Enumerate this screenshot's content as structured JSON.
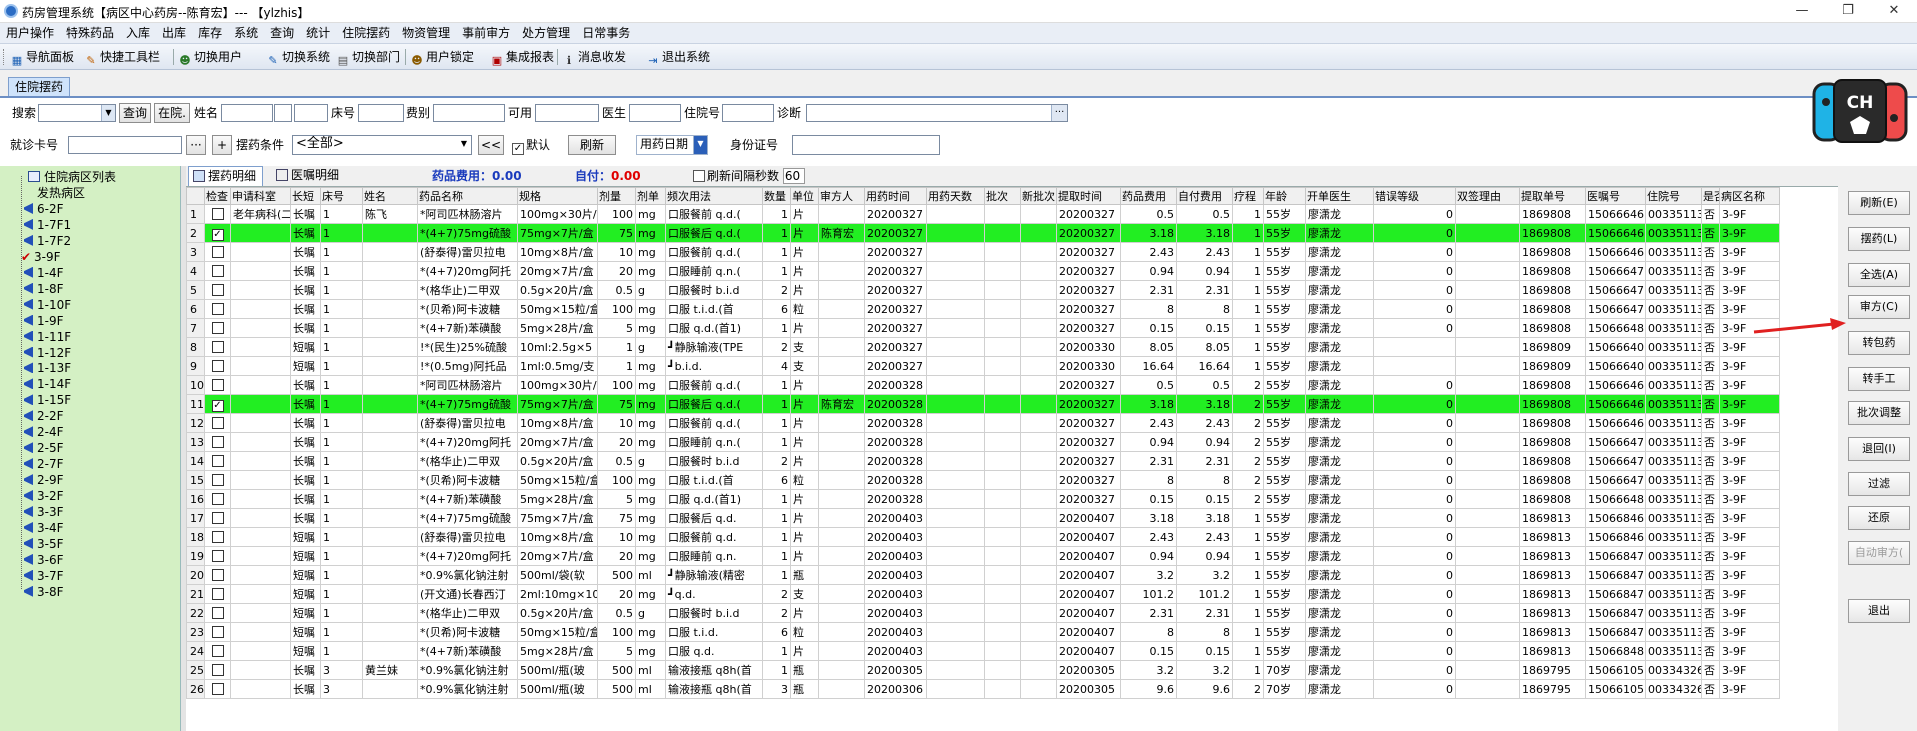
{
  "window": {
    "title": "药房管理系统【病区中心药房--陈育宏】--- 【ylzhis】",
    "min": "—",
    "max": "❐",
    "close": "✕"
  },
  "menu": [
    "用户操作",
    "特殊药品",
    "入库",
    "出库",
    "库存",
    "系统",
    "查询",
    "统计",
    "住院摆药",
    "物资管理",
    "事前审方",
    "处方管理",
    "日常事务"
  ],
  "toolbar": [
    {
      "label": "导航面板",
      "icon": "nav-panel-icon",
      "glyph": "▦",
      "color": "#1a5fb4"
    },
    {
      "label": "快捷工具栏",
      "icon": "shortcut-tools-icon",
      "glyph": "✎",
      "color": "#c06000"
    },
    {
      "label": "切换用户",
      "icon": "switch-user-icon",
      "glyph": "☻",
      "color": "#2a7a2a"
    },
    {
      "label": "切换系统",
      "icon": "switch-system-icon",
      "glyph": "✎",
      "color": "#1a5fb4"
    },
    {
      "label": "切换部门",
      "icon": "switch-dept-icon",
      "glyph": "▤",
      "color": "#555"
    },
    {
      "label": "用户锁定",
      "icon": "user-lock-icon",
      "glyph": "☻",
      "color": "#8a5a00"
    },
    {
      "label": "集成报表",
      "icon": "report-icon",
      "glyph": "▣",
      "color": "#b00000"
    },
    {
      "label": "消息收发",
      "icon": "message-icon",
      "glyph": "ℹ",
      "color": "#333"
    },
    {
      "label": "退出系统",
      "icon": "exit-icon",
      "glyph": "⇥",
      "color": "#1a5fb4"
    }
  ],
  "doc_tab": "住院摆药",
  "filters": {
    "search_label": "搜索",
    "query_btn": "查询",
    "inpatient_btn": "在院.",
    "name_label": "姓名",
    "bed_label": "床号",
    "fee_label": "费别",
    "usable_label": "可用",
    "doctor_label": "医生",
    "hosp_label": "住院号",
    "diag_label": "诊断",
    "diag_btn": "···",
    "card_label": "就诊卡号",
    "dots_btn": "···",
    "plus_btn": "+",
    "cond_label": "摆药条件",
    "cond_value": "<全部>",
    "back_btn": "<<",
    "default_label": "默认",
    "refresh_btn": "刷新",
    "date_value": "用药日期",
    "id_label": "身份证号"
  },
  "tree": {
    "root": "住院病区列表",
    "items": [
      "发热病区",
      "6-2F",
      "1-7F1",
      "1-7F2",
      "3-9F",
      "1-4F",
      "1-8F",
      "1-10F",
      "1-9F",
      "1-11F",
      "1-12F",
      "1-13F",
      "1-14F",
      "1-15F",
      "2-2F",
      "2-4F",
      "2-5F",
      "2-7F",
      "2-9F",
      "3-2F",
      "3-3F",
      "3-4F",
      "3-5F",
      "3-6F",
      "3-7F",
      "3-8F"
    ],
    "checked_item": "3-9F"
  },
  "main_tabs": [
    "摆药明细",
    "医嘱明细"
  ],
  "fee_bar": {
    "fee_label": "药品费用：",
    "fee_value": "0.00",
    "self_label": "自付：",
    "self_value": "0.00",
    "refresh_label": "刷新间隔秒数",
    "refresh_value": "60"
  },
  "columns": [
    "检查",
    "申请科室",
    "长短",
    "床号",
    "姓名",
    "药品名称",
    "规格",
    "剂量",
    "剂单",
    "频次用法",
    "数量",
    "单位",
    "审方人",
    "用药时间",
    "用药天数",
    "批次",
    "新批次",
    "提取时间",
    "药品费用",
    "自付费用",
    "疗程",
    "年龄",
    "开单医生",
    "错误等级",
    "双签理由",
    "提取单号",
    "医嘱号",
    "住院号",
    "是否",
    "病区名称"
  ],
  "rows": [
    [
      "1",
      "false",
      "老年病科(二",
      "长嘱",
      "1",
      "陈飞",
      "*阿司匹林肠溶片",
      "100mg×30片/",
      "100",
      "mg",
      "口服餐前 q.d.(",
      "1",
      "片",
      "",
      "20200327",
      "",
      "",
      "",
      "20200327",
      "0.5",
      "0.5",
      "1",
      "55岁",
      "廖潇龙",
      "0",
      "",
      "1869808",
      "15066646",
      "00335113",
      "否",
      "3-9F"
    ],
    [
      "2",
      "true",
      "",
      "长嘱",
      "1",
      "",
      "*(4+7)75mg硫酸",
      "75mg×7片/盒",
      "75",
      "mg",
      "口服餐后 q.d.(",
      "1",
      "片",
      "陈育宏",
      "20200327",
      "",
      "",
      "",
      "20200327",
      "3.18",
      "3.18",
      "1",
      "55岁",
      "廖潇龙",
      "0",
      "",
      "1869808",
      "15066646",
      "00335113",
      "否",
      "3-9F"
    ],
    [
      "3",
      "false",
      "",
      "长嘱",
      "1",
      "",
      "(舒泰得)雷贝拉电",
      "10mg×8片/盒",
      "10",
      "mg",
      "口服餐前 q.d.(",
      "1",
      "片",
      "",
      "20200327",
      "",
      "",
      "",
      "20200327",
      "2.43",
      "2.43",
      "1",
      "55岁",
      "廖潇龙",
      "0",
      "",
      "1869808",
      "15066646",
      "00335113",
      "否",
      "3-9F"
    ],
    [
      "4",
      "false",
      "",
      "长嘱",
      "1",
      "",
      "*(4+7)20mg阿托",
      "20mg×7片/盒",
      "20",
      "mg",
      "口服睡前 q.n.(",
      "1",
      "片",
      "",
      "20200327",
      "",
      "",
      "",
      "20200327",
      "0.94",
      "0.94",
      "1",
      "55岁",
      "廖潇龙",
      "0",
      "",
      "1869808",
      "15066647",
      "00335113",
      "否",
      "3-9F"
    ],
    [
      "5",
      "false",
      "",
      "长嘱",
      "1",
      "",
      "*(格华止)二甲双",
      "0.5g×20片/盒",
      "0.5",
      "g",
      "口服餐时 b.i.d",
      "2",
      "片",
      "",
      "20200327",
      "",
      "",
      "",
      "20200327",
      "2.31",
      "2.31",
      "1",
      "55岁",
      "廖潇龙",
      "0",
      "",
      "1869808",
      "15066647",
      "00335113",
      "否",
      "3-9F"
    ],
    [
      "6",
      "false",
      "",
      "长嘱",
      "1",
      "",
      "*(贝希)阿卡波糖",
      "50mg×15粒/盒",
      "100",
      "mg",
      "口服 t.i.d.(首",
      "6",
      "粒",
      "",
      "20200327",
      "",
      "",
      "",
      "20200327",
      "8",
      "8",
      "1",
      "55岁",
      "廖潇龙",
      "0",
      "",
      "1869808",
      "15066647",
      "00335113",
      "否",
      "3-9F"
    ],
    [
      "7",
      "false",
      "",
      "长嘱",
      "1",
      "",
      "*(4+7新)苯磺酸",
      "5mg×28片/盒",
      "5",
      "mg",
      "口服 q.d.(首1)",
      "1",
      "片",
      "",
      "20200327",
      "",
      "",
      "",
      "20200327",
      "0.15",
      "0.15",
      "1",
      "55岁",
      "廖潇龙",
      "0",
      "",
      "1869808",
      "15066648",
      "00335113",
      "否",
      "3-9F"
    ],
    [
      "8",
      "false",
      "",
      "短嘱",
      "1",
      "",
      "!*(民生)25%硫酸",
      "10ml:2.5g×5",
      "1",
      "g",
      "┛静脉输液(TPE",
      "2",
      "支",
      "",
      "20200327",
      "",
      "",
      "",
      "20200330",
      "8.05",
      "8.05",
      "1",
      "55岁",
      "廖潇龙",
      "",
      "",
      "1869809",
      "15066640",
      "00335113",
      "否",
      "3-9F"
    ],
    [
      "9",
      "false",
      "",
      "短嘱",
      "1",
      "",
      "!*(0.5mg)阿托品",
      "1ml:0.5mg/支",
      "1",
      "mg",
      "┛b.i.d.",
      "4",
      "支",
      "",
      "20200327",
      "",
      "",
      "",
      "20200330",
      "16.64",
      "16.64",
      "1",
      "55岁",
      "廖潇龙",
      "",
      "",
      "1869809",
      "15066640",
      "00335113",
      "否",
      "3-9F"
    ],
    [
      "10",
      "false",
      "",
      "长嘱",
      "1",
      "",
      "*阿司匹林肠溶片",
      "100mg×30片/",
      "100",
      "mg",
      "口服餐前 q.d.(",
      "1",
      "片",
      "",
      "20200328",
      "",
      "",
      "",
      "20200327",
      "0.5",
      "0.5",
      "2",
      "55岁",
      "廖潇龙",
      "0",
      "",
      "1869808",
      "15066646",
      "00335113",
      "否",
      "3-9F"
    ],
    [
      "11",
      "true",
      "",
      "长嘱",
      "1",
      "",
      "*(4+7)75mg硫酸",
      "75mg×7片/盒",
      "75",
      "mg",
      "口服餐后 q.d.(",
      "1",
      "片",
      "陈育宏",
      "20200328",
      "",
      "",
      "",
      "20200327",
      "3.18",
      "3.18",
      "2",
      "55岁",
      "廖潇龙",
      "0",
      "",
      "1869808",
      "15066646",
      "00335113",
      "否",
      "3-9F"
    ],
    [
      "12",
      "false",
      "",
      "长嘱",
      "1",
      "",
      "(舒泰得)雷贝拉电",
      "10mg×8片/盒",
      "10",
      "mg",
      "口服餐前 q.d.(",
      "1",
      "片",
      "",
      "20200328",
      "",
      "",
      "",
      "20200327",
      "2.43",
      "2.43",
      "2",
      "55岁",
      "廖潇龙",
      "0",
      "",
      "1869808",
      "15066646",
      "00335113",
      "否",
      "3-9F"
    ],
    [
      "13",
      "false",
      "",
      "长嘱",
      "1",
      "",
      "*(4+7)20mg阿托",
      "20mg×7片/盒",
      "20",
      "mg",
      "口服睡前 q.n.(",
      "1",
      "片",
      "",
      "20200328",
      "",
      "",
      "",
      "20200327",
      "0.94",
      "0.94",
      "2",
      "55岁",
      "廖潇龙",
      "0",
      "",
      "1869808",
      "15066647",
      "00335113",
      "否",
      "3-9F"
    ],
    [
      "14",
      "false",
      "",
      "长嘱",
      "1",
      "",
      "*(格华止)二甲双",
      "0.5g×20片/盒",
      "0.5",
      "g",
      "口服餐时 b.i.d",
      "2",
      "片",
      "",
      "20200328",
      "",
      "",
      "",
      "20200327",
      "2.31",
      "2.31",
      "2",
      "55岁",
      "廖潇龙",
      "0",
      "",
      "1869808",
      "15066647",
      "00335113",
      "否",
      "3-9F"
    ],
    [
      "15",
      "false",
      "",
      "长嘱",
      "1",
      "",
      "*(贝希)阿卡波糖",
      "50mg×15粒/盒",
      "100",
      "mg",
      "口服 t.i.d.(首",
      "6",
      "粒",
      "",
      "20200328",
      "",
      "",
      "",
      "20200327",
      "8",
      "8",
      "2",
      "55岁",
      "廖潇龙",
      "0",
      "",
      "1869808",
      "15066647",
      "00335113",
      "否",
      "3-9F"
    ],
    [
      "16",
      "false",
      "",
      "长嘱",
      "1",
      "",
      "*(4+7新)苯磺酸",
      "5mg×28片/盒",
      "5",
      "mg",
      "口服 q.d.(首1)",
      "1",
      "片",
      "",
      "20200328",
      "",
      "",
      "",
      "20200327",
      "0.15",
      "0.15",
      "2",
      "55岁",
      "廖潇龙",
      "0",
      "",
      "1869808",
      "15066648",
      "00335113",
      "否",
      "3-9F"
    ],
    [
      "17",
      "false",
      "",
      "长嘱",
      "1",
      "",
      "*(4+7)75mg硫酸",
      "75mg×7片/盒",
      "75",
      "mg",
      "口服餐后 q.d.",
      "1",
      "片",
      "",
      "20200403",
      "",
      "",
      "",
      "20200407",
      "3.18",
      "3.18",
      "1",
      "55岁",
      "廖潇龙",
      "0",
      "",
      "1869813",
      "15066846",
      "00335113",
      "否",
      "3-9F"
    ],
    [
      "18",
      "false",
      "",
      "短嘱",
      "1",
      "",
      "(舒泰得)雷贝拉电",
      "10mg×8片/盒",
      "10",
      "mg",
      "口服餐前 q.d.",
      "1",
      "片",
      "",
      "20200403",
      "",
      "",
      "",
      "20200407",
      "2.43",
      "2.43",
      "1",
      "55岁",
      "廖潇龙",
      "0",
      "",
      "1869813",
      "15066846",
      "00335113",
      "否",
      "3-9F"
    ],
    [
      "19",
      "false",
      "",
      "短嘱",
      "1",
      "",
      "*(4+7)20mg阿托",
      "20mg×7片/盒",
      "20",
      "mg",
      "口服睡前 q.n.",
      "1",
      "片",
      "",
      "20200403",
      "",
      "",
      "",
      "20200407",
      "0.94",
      "0.94",
      "1",
      "55岁",
      "廖潇龙",
      "0",
      "",
      "1869813",
      "15066847",
      "00335113",
      "否",
      "3-9F"
    ],
    [
      "20",
      "false",
      "",
      "短嘱",
      "1",
      "",
      "*0.9%氯化钠注射",
      "500ml/袋(软",
      "500",
      "ml",
      "┛静脉输液(精密",
      "1",
      "瓶",
      "",
      "20200403",
      "",
      "",
      "",
      "20200407",
      "3.2",
      "3.2",
      "1",
      "55岁",
      "廖潇龙",
      "0",
      "",
      "1869813",
      "15066847",
      "00335113",
      "否",
      "3-9F"
    ],
    [
      "21",
      "false",
      "",
      "短嘱",
      "1",
      "",
      "(开文通)长春西汀",
      "2ml:10mg×10",
      "20",
      "mg",
      "┛q.d.",
      "2",
      "支",
      "",
      "20200403",
      "",
      "",
      "",
      "20200407",
      "101.2",
      "101.2",
      "1",
      "55岁",
      "廖潇龙",
      "0",
      "",
      "1869813",
      "15066847",
      "00335113",
      "否",
      "3-9F"
    ],
    [
      "22",
      "false",
      "",
      "短嘱",
      "1",
      "",
      "*(格华止)二甲双",
      "0.5g×20片/盒",
      "0.5",
      "g",
      "口服餐时 b.i.d",
      "2",
      "片",
      "",
      "20200403",
      "",
      "",
      "",
      "20200407",
      "2.31",
      "2.31",
      "1",
      "55岁",
      "廖潇龙",
      "0",
      "",
      "1869813",
      "15066847",
      "00335113",
      "否",
      "3-9F"
    ],
    [
      "23",
      "false",
      "",
      "短嘱",
      "1",
      "",
      "*(贝希)阿卡波糖",
      "50mg×15粒/盒",
      "100",
      "mg",
      "口服 t.i.d.",
      "6",
      "粒",
      "",
      "20200403",
      "",
      "",
      "",
      "20200407",
      "8",
      "8",
      "1",
      "55岁",
      "廖潇龙",
      "0",
      "",
      "1869813",
      "15066847",
      "00335113",
      "否",
      "3-9F"
    ],
    [
      "24",
      "false",
      "",
      "短嘱",
      "1",
      "",
      "*(4+7新)苯磺酸",
      "5mg×28片/盒",
      "5",
      "mg",
      "口服 q.d.",
      "1",
      "片",
      "",
      "20200403",
      "",
      "",
      "",
      "20200407",
      "0.15",
      "0.15",
      "1",
      "55岁",
      "廖潇龙",
      "0",
      "",
      "1869813",
      "15066848",
      "00335113",
      "否",
      "3-9F"
    ],
    [
      "25",
      "false",
      "",
      "长嘱",
      "3",
      "黄兰妹",
      "*0.9%氯化钠注射",
      "500ml/瓶(玻",
      "500",
      "ml",
      "输液接瓶 q8h(首",
      "1",
      "瓶",
      "",
      "20200305",
      "",
      "",
      "",
      "20200305",
      "3.2",
      "3.2",
      "1",
      "70岁",
      "廖潇龙",
      "0",
      "",
      "1869795",
      "15066105",
      "00334326",
      "否",
      "3-9F"
    ],
    [
      "26",
      "false",
      "",
      "长嘱",
      "3",
      "",
      "*0.9%氯化钠注射",
      "500ml/瓶(玻",
      "500",
      "ml",
      "输液接瓶 q8h(首",
      "3",
      "瓶",
      "",
      "20200306",
      "",
      "",
      "",
      "20200305",
      "9.6",
      "9.6",
      "2",
      "70岁",
      "廖潇龙",
      "0",
      "",
      "1869795",
      "15066105",
      "00334326",
      "否",
      "3-9F"
    ]
  ],
  "highlight_rows": [
    2,
    11
  ],
  "right_buttons": [
    {
      "label": "刷新(E)",
      "enabled": true
    },
    {
      "label": "摆药(L)",
      "enabled": true
    },
    {
      "label": "全选(A)",
      "enabled": true
    },
    {
      "label": "审方(C)",
      "enabled": true
    },
    {
      "label": "转包药",
      "enabled": true
    },
    {
      "label": "转手工",
      "enabled": true
    },
    {
      "label": "批次调整",
      "enabled": true
    },
    {
      "label": "退回(I)",
      "enabled": true
    },
    {
      "label": "过滤",
      "enabled": true
    },
    {
      "label": "还原",
      "enabled": true
    },
    {
      "label": "自动审方(",
      "enabled": false
    },
    {
      "label": "退出",
      "enabled": true
    }
  ],
  "logo_text": "CH",
  "colors": {
    "highlight": "#22ee22",
    "tree_bg": "#d4f0c4",
    "accent": "#2250b8",
    "fee_red": "#e00000",
    "fee_blue": "#1a3bbd",
    "arrow": "#e02020"
  }
}
